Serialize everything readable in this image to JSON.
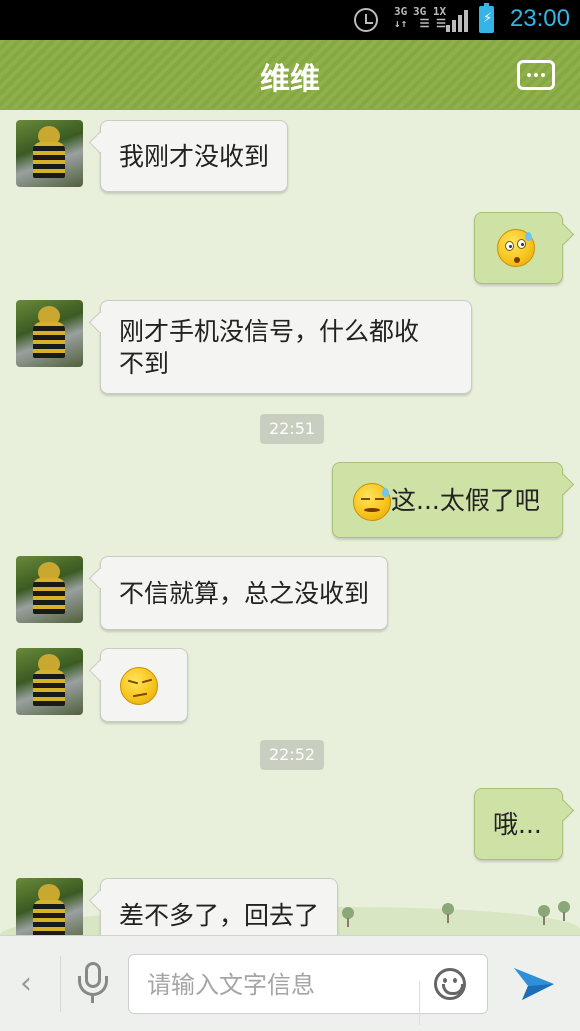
{
  "status_bar": {
    "time": "23:00",
    "network_1": "3G\n↓↑",
    "network_2": "3G 1X\n☰ ☰"
  },
  "header": {
    "title": "维维",
    "more_icon": "more-options-icon"
  },
  "messages": [
    {
      "side": "in",
      "type": "text",
      "text": "我刚才没收到"
    },
    {
      "side": "out",
      "type": "emoji",
      "emoji": "sweat-confused"
    },
    {
      "side": "in",
      "type": "text",
      "text": "刚才手机没信号，什么都收\n不到"
    },
    {
      "side": "time",
      "text": "22:51"
    },
    {
      "side": "out",
      "type": "emoji-text",
      "emoji": "sweat-squint",
      "text": "这...太假了吧"
    },
    {
      "side": "in",
      "type": "text",
      "text": "不信就算，总之没收到"
    },
    {
      "side": "in",
      "type": "emoji",
      "emoji": "smug"
    },
    {
      "side": "time",
      "text": "22:52"
    },
    {
      "side": "out",
      "type": "text",
      "text": "哦..."
    },
    {
      "side": "in",
      "type": "text",
      "text": "差不多了，回去了"
    }
  ],
  "input_bar": {
    "back_icon": "chevron-left-icon",
    "mic_icon": "microphone-icon",
    "placeholder": "请输入文字信息",
    "emoji_icon": "smiley-icon",
    "send_icon": "send-icon"
  },
  "colors": {
    "header_green": "#8aab46",
    "chat_background": "#e8efdb",
    "outgoing_bubble": "#cfe2a6",
    "incoming_bubble": "#f4f4f2",
    "status_blue": "#35b5e5"
  }
}
